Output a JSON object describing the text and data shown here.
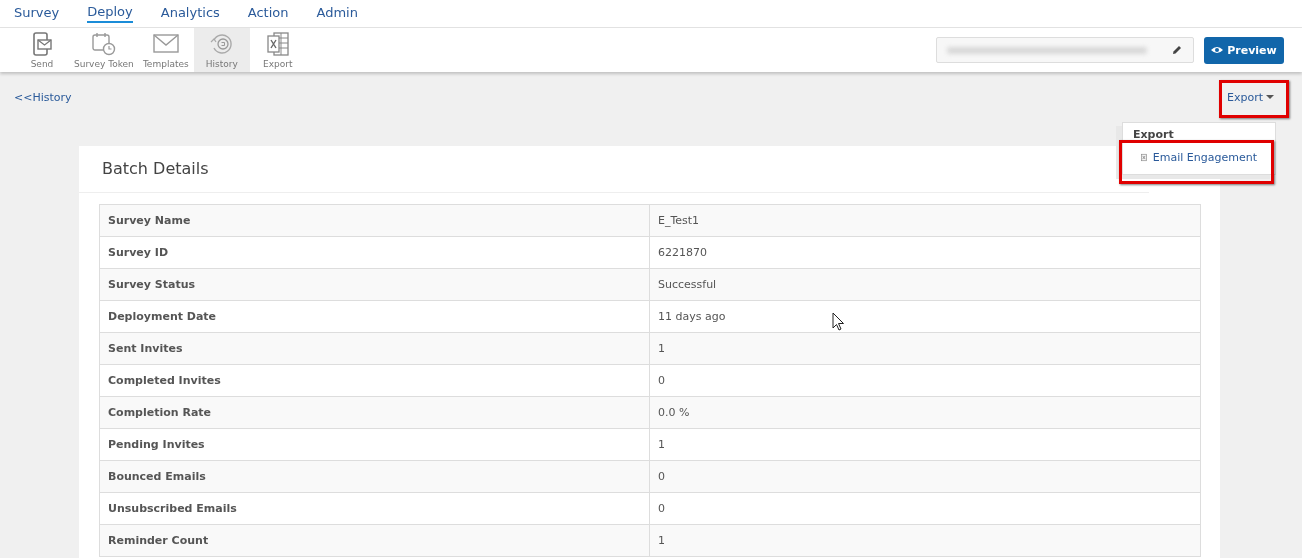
{
  "nav": [
    {
      "label": "Survey",
      "selected": false
    },
    {
      "label": "Deploy",
      "selected": true
    },
    {
      "label": "Analytics",
      "selected": false
    },
    {
      "label": "Action",
      "selected": false
    },
    {
      "label": "Admin",
      "selected": false
    }
  ],
  "toolbar": [
    {
      "kind": "send",
      "label": "Send",
      "selected": false
    },
    {
      "kind": "token",
      "label": "Survey Token",
      "selected": false
    },
    {
      "kind": "templates",
      "label": "Templates",
      "selected": false
    },
    {
      "kind": "history",
      "label": "History",
      "selected": true
    },
    {
      "kind": "export",
      "label": "Export",
      "selected": false
    }
  ],
  "preview_button": "Preview",
  "back_link": "<<History",
  "export_menu": {
    "label": "Export",
    "header": "Export",
    "items": [
      "Email Engagement"
    ]
  },
  "batch_details": {
    "title": "Batch Details",
    "rows": [
      {
        "label": "Survey Name",
        "value": "E_Test1"
      },
      {
        "label": "Survey ID",
        "value": "6221870"
      },
      {
        "label": "Survey Status",
        "value": "Successful"
      },
      {
        "label": "Deployment Date",
        "value": "11 days ago"
      },
      {
        "label": "Sent Invites",
        "value": "1"
      },
      {
        "label": "Completed Invites",
        "value": "0"
      },
      {
        "label": "Completion Rate",
        "value": "0.0 %"
      },
      {
        "label": "Pending Invites",
        "value": "1"
      },
      {
        "label": "Bounced Emails",
        "value": "0"
      },
      {
        "label": "Unsubscribed Emails",
        "value": "0"
      },
      {
        "label": "Reminder Count",
        "value": "1"
      }
    ]
  }
}
